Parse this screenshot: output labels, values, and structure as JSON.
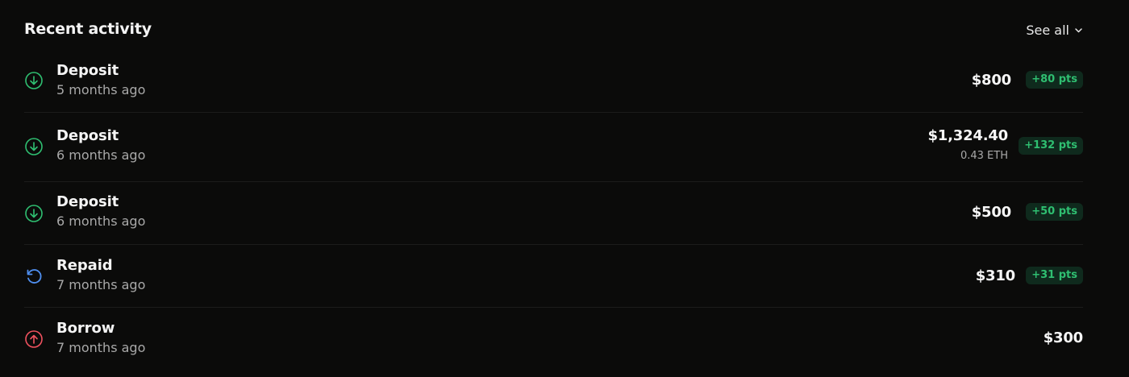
{
  "header": {
    "title": "Recent activity",
    "see_all": "See all"
  },
  "colors": {
    "deposit": "#2fbf71",
    "repaid": "#4f8ff0",
    "borrow": "#f0525f"
  },
  "rows": [
    {
      "type": "Deposit",
      "icon": "arrow-down-circle-icon",
      "time": "5 months ago",
      "amount": "$800",
      "points": "+80 pts"
    },
    {
      "type": "Deposit",
      "icon": "arrow-down-circle-icon",
      "time": "6 months ago",
      "amount": "$1,324.40",
      "sub_amount": "0.43 ETH",
      "points": "+132 pts"
    },
    {
      "type": "Deposit",
      "icon": "arrow-down-circle-icon",
      "time": "6 months ago",
      "amount": "$500",
      "points": "+50 pts"
    },
    {
      "type": "Repaid",
      "icon": "refresh-icon",
      "time": "7 months ago",
      "amount": "$310",
      "points": "+31 pts"
    },
    {
      "type": "Borrow",
      "icon": "arrow-up-circle-icon",
      "time": "7 months ago",
      "amount": "$300"
    }
  ]
}
